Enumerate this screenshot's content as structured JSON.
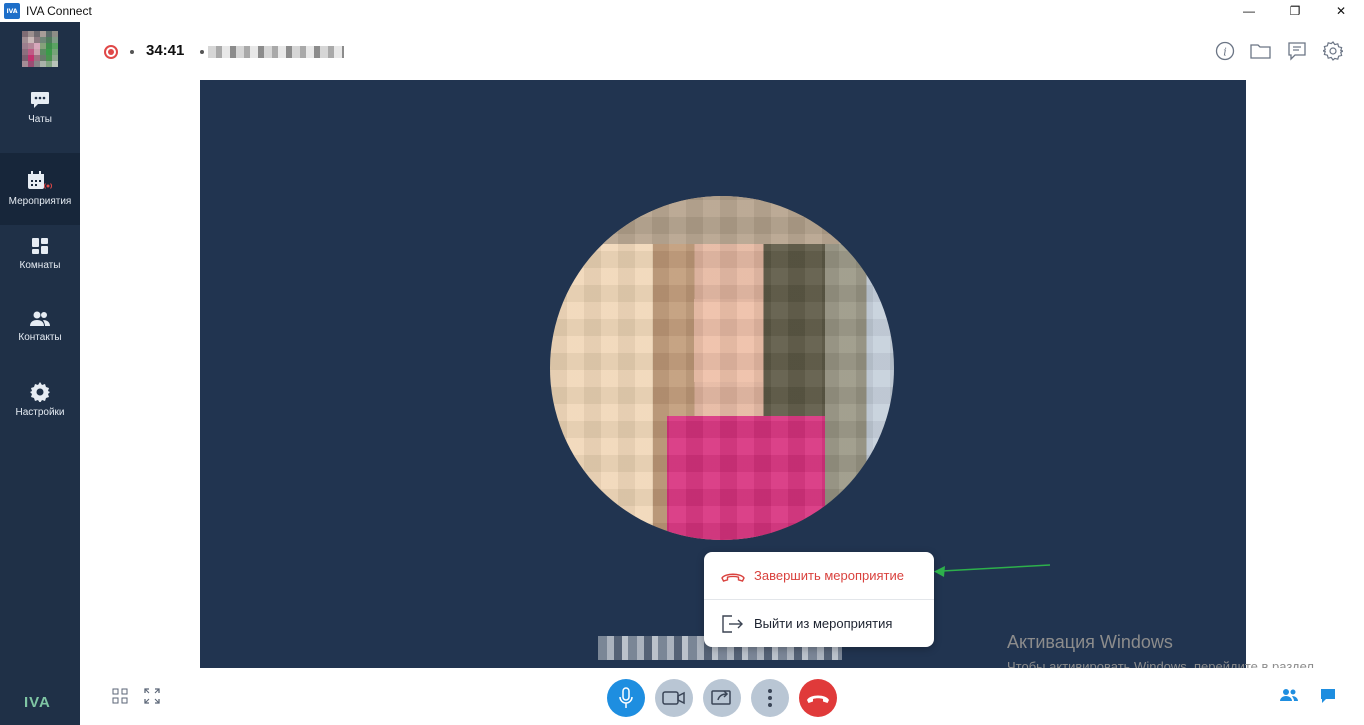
{
  "window": {
    "logo_text": "IVA",
    "title": "IVA Connect",
    "minimize": "—",
    "restore": "❐",
    "close": "✕"
  },
  "sidebar": {
    "items": [
      {
        "label": "Чаты",
        "icon": "chat-icon"
      },
      {
        "label": "Мероприятия",
        "icon": "calendar-live-icon"
      },
      {
        "label": "Комнаты",
        "icon": "rooms-icon"
      },
      {
        "label": "Контакты",
        "icon": "contacts-icon"
      },
      {
        "label": "Настройки",
        "icon": "gear-icon"
      }
    ],
    "active": "Мероприятия",
    "brand": "IVA"
  },
  "topbar": {
    "timer": "34:41",
    "recording": true,
    "icons": [
      "info-icon",
      "folder-icon",
      "chat-note-icon",
      "settings-icon"
    ]
  },
  "context_menu": {
    "end_event": "Завершить мероприятие",
    "leave_event": "Выйти из мероприятия"
  },
  "activation": {
    "title": "Активация Windows",
    "subtitle": "Чтобы активировать Windows, перейдите в раздел \"Параметры\"."
  },
  "controls": {
    "buttons": [
      "microphone-icon",
      "camera-icon",
      "share-screen-icon",
      "more-icon",
      "hangup-icon"
    ],
    "left": [
      "grid-layout-icon",
      "fullscreen-icon"
    ],
    "right": [
      "participants-icon",
      "chat-icon"
    ]
  },
  "colors": {
    "sidebar": "#1f3047",
    "stage": "#213450",
    "accent": "#1e8ee0",
    "danger": "#e03a3a",
    "arrow": "#2db04b"
  }
}
